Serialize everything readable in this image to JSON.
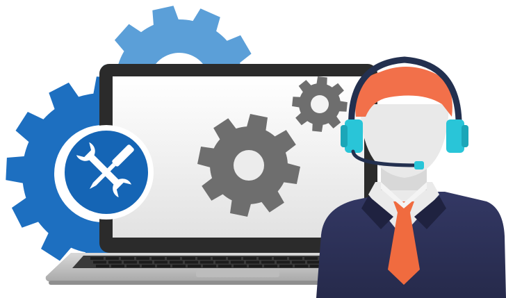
{
  "illustration": {
    "icons": [
      "gear-icon",
      "wrench-screwdriver-icon",
      "laptop-icon",
      "headset-icon",
      "support-agent-icon"
    ],
    "colors": {
      "gear_blue_light": "#5b9fd8",
      "gear_blue_dark": "#1d6fc0",
      "badge_blue": "#1565b5",
      "screen_gear_gray": "#6e6e6e",
      "laptop_body": "#2b2b2b",
      "laptop_screen": "#efefef",
      "agent_hair": "#f2704a",
      "agent_suit": "#2d3155",
      "agent_tie": "#f06b3f",
      "headset_cyan": "#29c5d8",
      "headset_band": "#23304f"
    }
  }
}
